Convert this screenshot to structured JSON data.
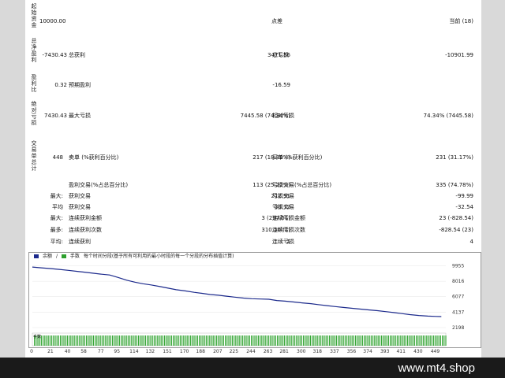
{
  "left_labels": [
    {
      "id": "initial",
      "text": "起始资金"
    },
    {
      "id": "net",
      "text": "总净盈利"
    },
    {
      "id": "pf",
      "text": "盈利比"
    },
    {
      "id": "abs",
      "text": "绝对亏损"
    },
    {
      "id": "trades",
      "text": "交易单总计"
    }
  ],
  "report": {
    "initial_value": "10000.00",
    "spread_label": "点差",
    "spread_value": "当前 (18)",
    "net_value": "-7430.43",
    "gross_profit_label": "总获利",
    "gross_profit_value": "3471.56",
    "gross_loss_label": "总亏损",
    "gross_loss_value": "-10901.99",
    "pf_value": "0.32",
    "expected_label": "预期盈利",
    "expected_value": "-16.59",
    "abs_value": "7430.43",
    "max_dd_label": "最大亏损",
    "max_dd_value": "7445.58 (74.34%)",
    "rel_dd_label": "相对亏损",
    "rel_dd_value": "74.34% (7445.58)",
    "trades_value": "448",
    "short_label": "卖单 (%获利百分比)",
    "short_value": "217 (18.89%)",
    "long_label": "买单 (%获利百分比)",
    "long_value": "231 (31.17%)",
    "win_label": "盈利交易(%占总百分比)",
    "win_value": "113 (25.22%)",
    "loss_label": "亏损交易(%占总百分比)",
    "loss_value": "335 (74.78%)",
    "rows": [
      {
        "prefix": "最大:",
        "l_label": "获利交易",
        "l_value": "212.91",
        "r_label": "亏损交易",
        "r_value": "-99.99"
      },
      {
        "prefix": "平均",
        "l_label": "获利交易",
        "l_value": "30.72",
        "r_label": "亏损交易",
        "r_value": "-32.54"
      },
      {
        "prefix": "最大:",
        "l_label": "连续获利金额",
        "l_value": "3 (297.51)",
        "r_label": "连续亏损金额",
        "r_value": "23 (-828.54)"
      },
      {
        "prefix": "最多:",
        "l_label": "连续获利次数",
        "l_value": "310.50 (2)",
        "r_label": "连续亏损次数",
        "r_value": "-828.54 (23)"
      },
      {
        "prefix": "平均:",
        "l_label": "连续获利",
        "l_value": "1",
        "r_label": "连续亏损",
        "r_value": "4"
      }
    ]
  },
  "chart_header": {
    "balance_label": "余额",
    "deal_label": "手数",
    "desc": "每个时间分段(基于所有可利用的最小时段的每一个分段的分布插值计算)"
  },
  "chart_data": {
    "type": "line",
    "y_ticks": [
      9955,
      8016,
      6077,
      4137,
      2198
    ],
    "ylim": [
      1700,
      10400
    ],
    "x_ticks": [
      0,
      21,
      40,
      58,
      77,
      95,
      114,
      132,
      151,
      170,
      188,
      207,
      225,
      244,
      263,
      281,
      300,
      318,
      337,
      356,
      374,
      393,
      411,
      430,
      449
    ],
    "x_max": 460,
    "lots_label": "手数",
    "series": [
      {
        "name": "余额",
        "color": "#1c2a8c",
        "x": [
          0,
          10,
          21,
          30,
          40,
          50,
          58,
          68,
          77,
          86,
          95,
          105,
          114,
          123,
          132,
          142,
          151,
          160,
          170,
          180,
          188,
          198,
          207,
          216,
          225,
          235,
          244,
          254,
          263,
          272,
          281,
          290,
          300,
          310,
          318,
          328,
          337,
          346,
          356,
          365,
          374,
          384,
          393,
          402,
          411,
          420,
          430,
          440,
          449,
          455
        ],
        "y": [
          9800,
          9700,
          9600,
          9500,
          9380,
          9250,
          9150,
          9020,
          8900,
          8800,
          8500,
          8150,
          7900,
          7700,
          7550,
          7350,
          7150,
          6950,
          6800,
          6620,
          6500,
          6350,
          6260,
          6140,
          6020,
          5900,
          5820,
          5780,
          5750,
          5600,
          5520,
          5420,
          5300,
          5200,
          5080,
          4950,
          4830,
          4730,
          4620,
          4520,
          4420,
          4320,
          4200,
          4080,
          3950,
          3830,
          3720,
          3640,
          3600,
          3580
        ]
      }
    ]
  },
  "watermark": "www.mt4.shop"
}
